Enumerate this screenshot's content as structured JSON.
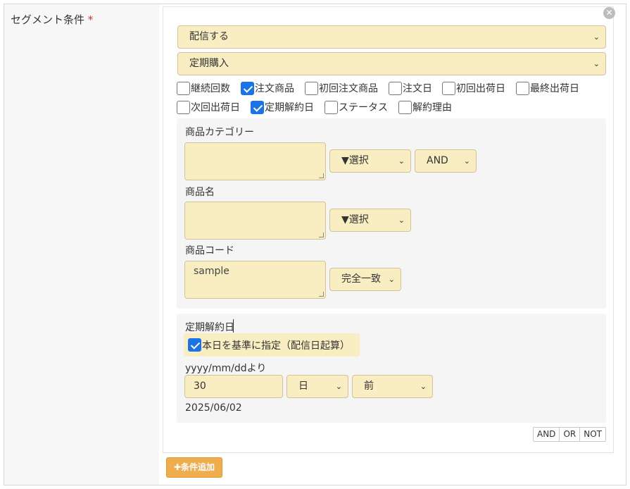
{
  "field": {
    "label": "セグメント条件",
    "required_mark": "*"
  },
  "panel": {
    "close_icon": "close-icon",
    "select_delivery": "配信する",
    "select_type": "定期購入",
    "checkboxes_row1": [
      {
        "label": "継続回数",
        "checked": false
      },
      {
        "label": "注文商品",
        "checked": true
      },
      {
        "label": "初回注文商品",
        "checked": false
      },
      {
        "label": "注文日",
        "checked": false
      },
      {
        "label": "初回出荷日",
        "checked": false
      },
      {
        "label": "最終出荷日",
        "checked": false
      }
    ],
    "checkboxes_row2": [
      {
        "label": "次回出荷日",
        "checked": false
      },
      {
        "label": "定期解約日",
        "checked": true
      },
      {
        "label": "ステータス",
        "checked": false
      },
      {
        "label": "解約理由",
        "checked": false
      }
    ]
  },
  "products": {
    "category_label": "商品カテゴリー",
    "category_value": "",
    "category_select": "▼選択",
    "category_logic": "AND",
    "name_label": "商品名",
    "name_value": "",
    "name_select": "▼選択",
    "code_label": "商品コード",
    "code_value": "sample",
    "code_match": "完全一致"
  },
  "cancel_date": {
    "label": "定期解約日",
    "today_label": "本日を基準に指定（配信日起算）",
    "today_checked": true,
    "format_label": "yyyy/mm/ddより",
    "offset_value": "30",
    "unit_select": "日",
    "direction_select": "前",
    "computed_date": "2025/06/02"
  },
  "logic_buttons": [
    "AND",
    "OR",
    "NOT"
  ],
  "add_button": "✚条件追加",
  "colors": {
    "field_bg": "#f9eec2",
    "checkbox_checked": "#1a73e8",
    "add_button": "#f0ad4e"
  }
}
